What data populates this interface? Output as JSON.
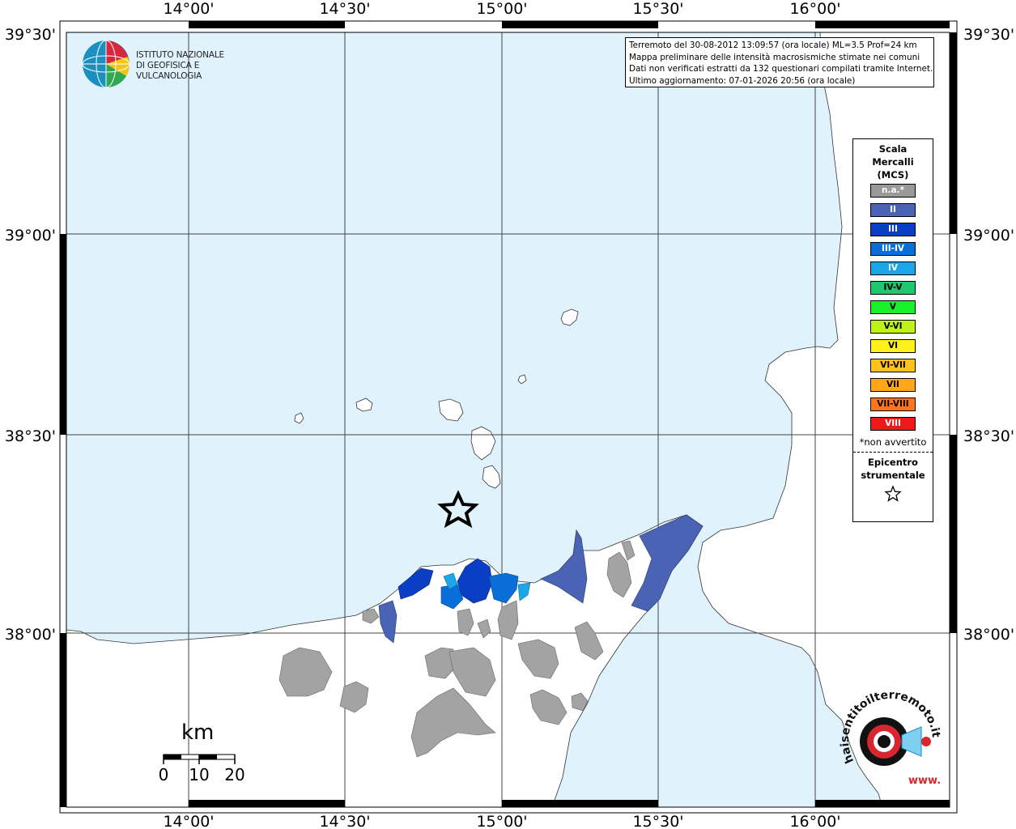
{
  "map": {
    "lon_labels": [
      "14°00'",
      "14°30'",
      "15°00'",
      "15°30'",
      "16°00'"
    ],
    "lat_labels": [
      "39°30'",
      "39°00'",
      "38°30'",
      "38°00'"
    ]
  },
  "logo": {
    "line1": "ISTITUTO NAZIONALE",
    "line2": "DI GEOFISICA E VULCANOLOGIA"
  },
  "info": {
    "line1": "Terremoto del 30-08-2012 13:09:57 (ora locale) ML=3.5 Prof=24 km",
    "line2": "Mappa preliminare delle intensità macrosismiche stimate nei comuni",
    "line3": "Dati non verificati estratti da 132 questionari compilati tramite Internet.",
    "line4": "Ultimo aggiornamento: 07-01-2026 20:56 (ora locale)"
  },
  "legend": {
    "title1": "Scala",
    "title2": "Mercalli",
    "title3": "(MCS)",
    "items": [
      {
        "label": "n.a.*",
        "color": "#999999",
        "text_color": "#ffffff"
      },
      {
        "label": "II",
        "color": "#4a63b5",
        "text_color": "#ffffff"
      },
      {
        "label": "III",
        "color": "#0a3ec4",
        "text_color": "#ffffff"
      },
      {
        "label": "III-IV",
        "color": "#0a6ed8",
        "text_color": "#ffffff"
      },
      {
        "label": "IV",
        "color": "#1aa6e8",
        "text_color": "#ffffff"
      },
      {
        "label": "IV-V",
        "color": "#1ec86e",
        "text_color": "#000000"
      },
      {
        "label": "V",
        "color": "#18f02a",
        "text_color": "#000000"
      },
      {
        "label": "V-VI",
        "color": "#bff21a",
        "text_color": "#000000"
      },
      {
        "label": "VI",
        "color": "#fff21a",
        "text_color": "#000000"
      },
      {
        "label": "VI-VII",
        "color": "#ffc21a",
        "text_color": "#000000"
      },
      {
        "label": "VII",
        "color": "#ffa61a",
        "text_color": "#000000"
      },
      {
        "label": "VII-VIII",
        "color": "#ff761a",
        "text_color": "#000000"
      },
      {
        "label": "VIII",
        "color": "#ee1a1a",
        "text_color": "#ffffff"
      }
    ],
    "note": "*non avvertito",
    "epi1": "Epicentro",
    "epi2": "strumentale",
    "epi_icon": "star-outline"
  },
  "scalebar": {
    "title": "km",
    "ticks": [
      "0",
      "10",
      "20"
    ]
  },
  "brand": {
    "text": "haisentitoilterremoto.it",
    "url_text": "www.",
    "icon": "target-speaker-icon"
  },
  "colors": {
    "sea": "#e0f3fd",
    "land": "#ffffff",
    "not_felt": "#a3a3a3",
    "intensity_II": "#4a63b5",
    "intensity_III": "#0a3ec4",
    "intensity_III_IV": "#0a6ed8",
    "intensity_IV": "#1aa6e8"
  }
}
